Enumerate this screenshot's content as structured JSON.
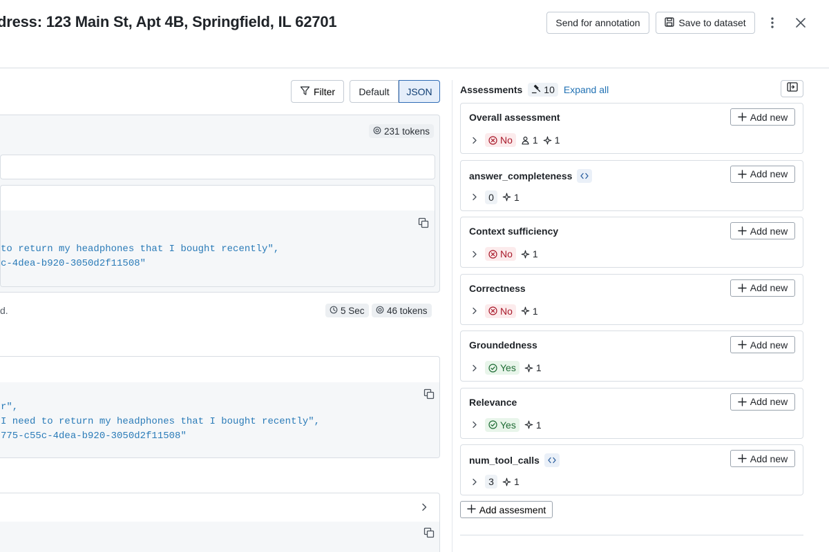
{
  "header": {
    "title": "dress: 123 Main St, Apt 4B, Springfield, IL 62701",
    "send_annotation_label": "Send for annotation",
    "save_dataset_label": "Save to dataset"
  },
  "toolbar": {
    "filter_label": "Filter",
    "view_modes": [
      "Default",
      "JSON"
    ],
    "selected_view": "JSON"
  },
  "content": {
    "span1": {
      "tokens": "231 tokens",
      "code_lines": [
        "to return my headphones that I bought recently\",",
        "c-4dea-b920-3050d2f11508\""
      ]
    },
    "span2": {
      "meta_text": "d.",
      "duration": "5 Sec",
      "tokens": "46 tokens",
      "code_lines": [
        "r\",",
        "I need to return my headphones that I bought recently\",",
        "775-c55c-4dea-b920-3050d2f11508\""
      ]
    }
  },
  "assessments": {
    "title": "Assessments",
    "count": "10",
    "expand_all_label": "Expand all",
    "add_new_label": "Add new",
    "add_assessment_label": "Add assesment",
    "items": [
      {
        "name": "Overall assessment",
        "code": false,
        "value": "No",
        "kind": "no",
        "human": "1",
        "ai": "1"
      },
      {
        "name": "answer_completeness",
        "code": true,
        "value": "0",
        "kind": "num",
        "human": null,
        "ai": "1"
      },
      {
        "name": "Context sufficiency",
        "code": false,
        "value": "No",
        "kind": "no",
        "human": null,
        "ai": "1"
      },
      {
        "name": "Correctness",
        "code": false,
        "value": "No",
        "kind": "no",
        "human": null,
        "ai": "1"
      },
      {
        "name": "Groundedness",
        "code": false,
        "value": "Yes",
        "kind": "yes",
        "human": null,
        "ai": "1"
      },
      {
        "name": "Relevance",
        "code": false,
        "value": "Yes",
        "kind": "yes",
        "human": null,
        "ai": "1"
      },
      {
        "name": "num_tool_calls",
        "code": true,
        "value": "3",
        "kind": "num",
        "human": null,
        "ai": "1"
      }
    ]
  },
  "colors": {
    "accent": "#2272b4",
    "no": "#a8192a",
    "yes": "#1d6b33",
    "code_text": "#2a7bb8"
  }
}
